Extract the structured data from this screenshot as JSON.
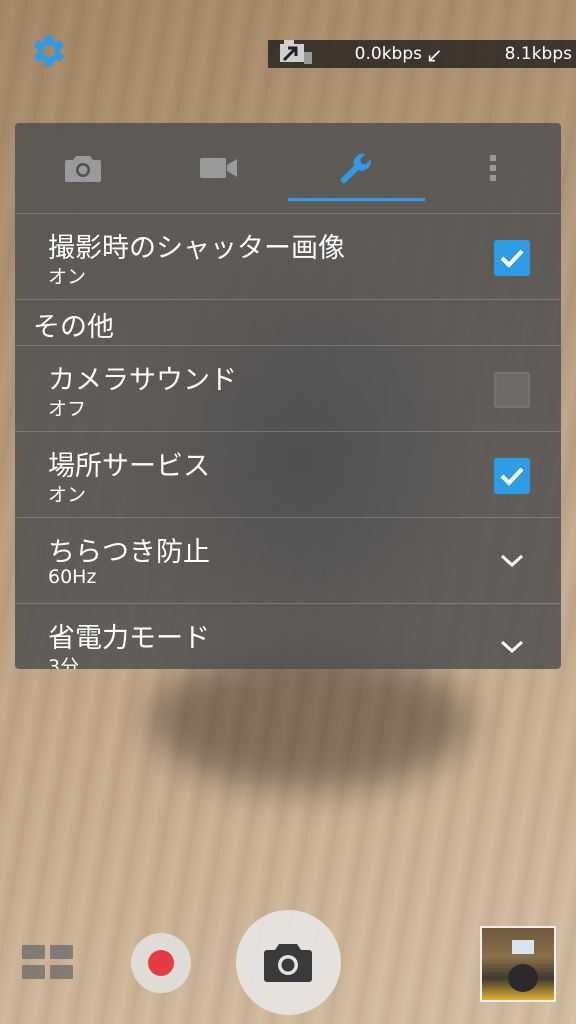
{
  "status": {
    "upload_rate": "0.0kbps",
    "download_rate": "8.1kbps"
  },
  "tabs": [
    {
      "name": "photo",
      "icon": "camera-icon"
    },
    {
      "name": "video",
      "icon": "video-icon"
    },
    {
      "name": "tools",
      "icon": "wrench-icon",
      "selected": true
    },
    {
      "name": "more",
      "icon": "more-vertical-icon"
    }
  ],
  "settings": {
    "shutter_image": {
      "title": "撮影時のシャッター画像",
      "value": "オン",
      "checked": true
    },
    "section_other": "その他",
    "camera_sound": {
      "title": "カメラサウンド",
      "value": "オフ",
      "checked": false
    },
    "location": {
      "title": "場所サービス",
      "value": "オン",
      "checked": true
    },
    "anti_flicker": {
      "title": "ちらつき防止",
      "value": "60Hz"
    },
    "power_saving": {
      "title": "省電力モード",
      "value": "3分"
    }
  },
  "colors": {
    "accent": "#2e9be6",
    "record": "#e53b43"
  }
}
